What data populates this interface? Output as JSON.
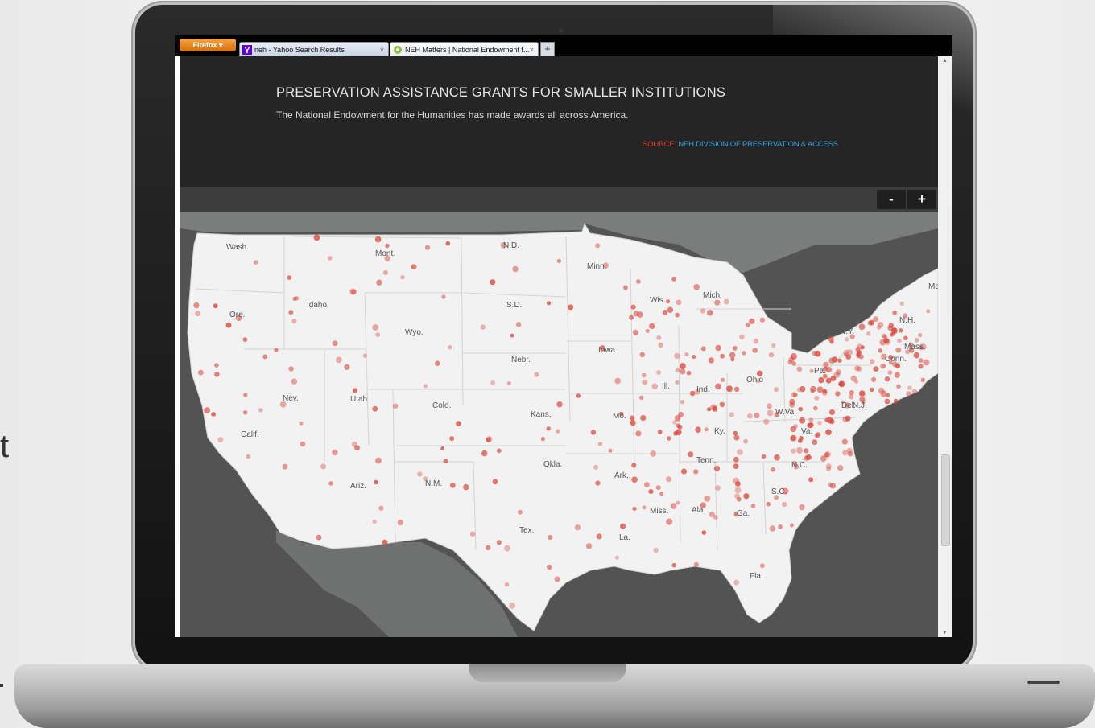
{
  "browser": {
    "menu_label": "Firefox ▾",
    "tabs": [
      {
        "label": "neh - Yahoo Search Results",
        "close": "×"
      },
      {
        "label": "NEH Matters | National Endowment f...",
        "close": "×"
      }
    ],
    "new_tab": "+"
  },
  "page": {
    "title": "PRESERVATION ASSISTANCE GRANTS FOR SMALLER INSTITUTIONS",
    "subtitle": "The National Endowment for the Humanities has made awards all across America.",
    "source_prefix": "SOURCE:",
    "source_text": "NEH DIVISION OF PRESERVATION & ACCESS"
  },
  "zoom": {
    "minus": "-",
    "plus": "+"
  },
  "map": {
    "state_labels": [
      "Wash.",
      "Mont.",
      "N.D.",
      "Minn.",
      "Ore.",
      "Idaho",
      "S.D.",
      "Wis.",
      "Mich.",
      "Wyo.",
      "Iowa",
      "N.Y.",
      "N.H.",
      "Nebr.",
      "Pa.",
      "Ohio",
      "Nev.",
      "Utah",
      "Colo.",
      "Ill.",
      "Ind.",
      "N.J.",
      "Calif.",
      "Kans.",
      "Mo.",
      "W.Va.",
      "Va.",
      "Ky.",
      "Okla.",
      "Tenn.",
      "N.C.",
      "Ariz.",
      "N.M.",
      "Ark.",
      "S.C.",
      "Miss.",
      "Ala.",
      "Ga.",
      "Tex.",
      "La.",
      "Fla.",
      "Me.",
      "Mass.",
      "Conn.",
      "Del."
    ],
    "colors": {
      "land": "#f2f2f2",
      "water": "#535353",
      "border": "#c9c9c9",
      "dot": "#d9473a"
    }
  },
  "stray_text": "t"
}
